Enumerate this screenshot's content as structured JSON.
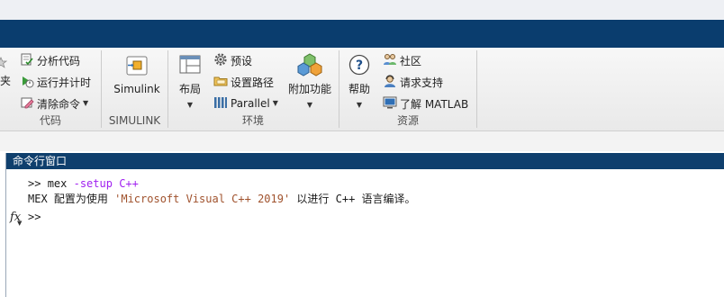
{
  "ribbon": {
    "code_section": {
      "partial_label": "夹",
      "analyze_code": "分析代码",
      "run_and_time": "运行并计时",
      "clear_commands": "清除命令",
      "section_label": "代码"
    },
    "simulink_section": {
      "simulink_button": "Simulink",
      "section_label": "SIMULINK"
    },
    "environment_section": {
      "layout_button": "布局",
      "preferences": "预设",
      "set_path": "设置路径",
      "parallel": "Parallel",
      "add_ons_button": "附加功能",
      "section_label": "环境"
    },
    "resources_section": {
      "help_button": "帮助",
      "community": "社区",
      "request_support": "请求支持",
      "learn_matlab": "了解 MATLAB",
      "section_label": "资源"
    }
  },
  "command_window": {
    "title": "命令行窗口",
    "line1": {
      "prompt": ">> ",
      "command": "mex",
      "option": "-setup",
      "arg": "C++"
    },
    "line2": {
      "text_before": "MEX 配置为使用 ",
      "quoted": "'Microsoft Visual C++ 2019'",
      "text_after": " 以进行 C++ 语言编译。"
    },
    "line3": {
      "prompt": ">>"
    }
  },
  "colors": {
    "title_bar": "#0a3d6e",
    "keyword_option": "#a020f0",
    "string": "#a0522d"
  }
}
